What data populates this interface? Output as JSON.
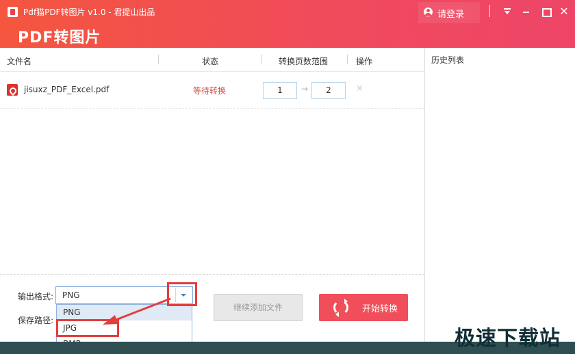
{
  "window": {
    "title": "Pdf猫PDF转图片 v1.0 - 君提山出品",
    "app_name": "PDF转图片",
    "login_label": "请登录"
  },
  "table": {
    "headers": {
      "filename": "文件名",
      "status": "状态",
      "page_range": "转换页数范围",
      "actions": "操作"
    },
    "rows": [
      {
        "filename": "jisuxz_PDF_Excel.pdf",
        "status": "等待转换",
        "page_from": "1",
        "page_to": "2",
        "remove_symbol": "×"
      }
    ]
  },
  "history": {
    "title": "历史列表"
  },
  "output": {
    "format_label": "输出格式:",
    "format_value": "PNG",
    "path_label": "保存路径:",
    "format_options": [
      "PNG",
      "JPG",
      "BMP"
    ],
    "highlighted_option": "PNG"
  },
  "buttons": {
    "add_files": "继续添加文件",
    "start": "开始转换"
  },
  "watermark": "极速下载站",
  "colors": {
    "title_gradient_start": "#f4563f",
    "title_gradient_end": "#ee4567",
    "status_text": "#d2504a",
    "start_button": "#ef4e5a",
    "annotation_red": "#e43c3c",
    "footer": "#2f4e51"
  },
  "icons": {
    "app": "app-logo-icon",
    "user": "user-icon",
    "menu": "menu-dropdown-icon",
    "minimize": "minimize-icon",
    "maximize": "maximize-icon",
    "close": "close-icon",
    "pdf": "pdf-file-icon",
    "arrow": "arrow-right-icon",
    "remove": "remove-icon",
    "refresh": "refresh-icon"
  }
}
